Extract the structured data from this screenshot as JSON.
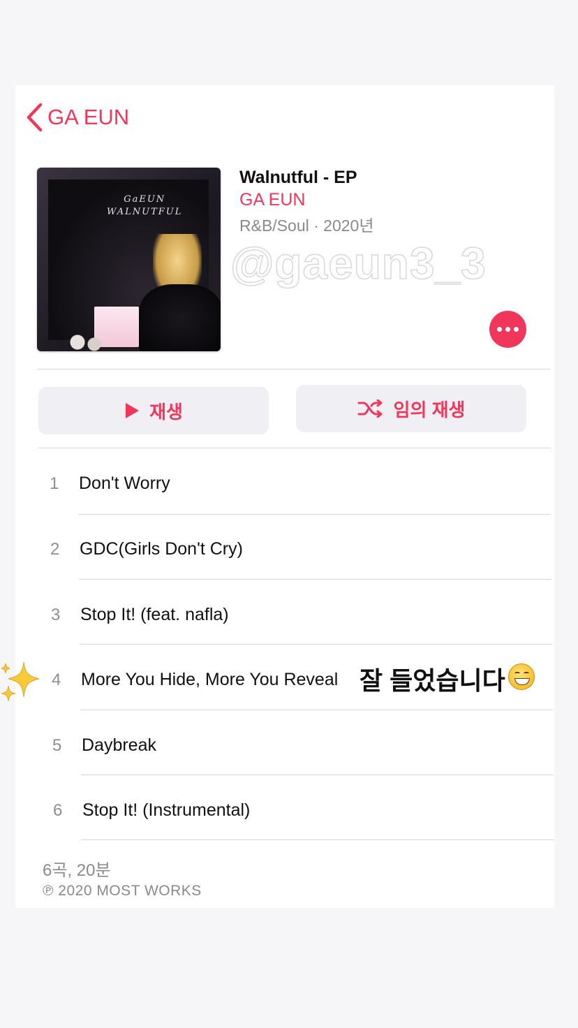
{
  "nav": {
    "back_label": "GA EUN"
  },
  "album": {
    "title": "Walnutful - EP",
    "artist": "GA EUN",
    "meta": "R&B/Soul · 2020년",
    "art_text_line1": "GaEUN",
    "art_text_line2": "WALNUTFUL"
  },
  "watermark": "@gaeun3_3",
  "actions": {
    "play_label": "재생",
    "shuffle_label": "임의 재생"
  },
  "tracks": [
    {
      "number": "1",
      "title": "Don't Worry"
    },
    {
      "number": "2",
      "title": "GDC(Girls Don't Cry)"
    },
    {
      "number": "3",
      "title": "Stop It! (feat. nafla)"
    },
    {
      "number": "4",
      "title": "More You Hide, More You Reveal"
    },
    {
      "number": "5",
      "title": "Daybreak"
    },
    {
      "number": "6",
      "title": "Stop It! (Instrumental)"
    }
  ],
  "overlay_caption": "잘 들었습니다",
  "footer": {
    "count": "6곡, 20분",
    "copyright": "℗ 2020 MOST WORKS"
  },
  "colors": {
    "accent": "#f0375b",
    "secondary_text": "#8a8a8e",
    "button_bg": "#efeff4"
  },
  "icons": {
    "back": "chevron-left-icon",
    "more": "ellipsis-icon",
    "play": "play-icon",
    "shuffle": "shuffle-icon",
    "emoji": "grinning-face-icon",
    "sparkles": "sparkles-icon"
  }
}
